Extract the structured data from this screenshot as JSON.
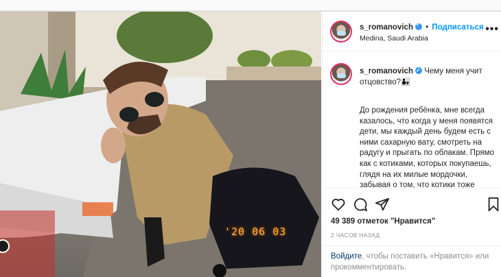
{
  "post": {
    "username": "s_romanovich",
    "follow_label": "Подписаться",
    "location": "Medina, Saudi Arabia",
    "photo_date_stamp": "'20 06 03",
    "caption_first": "Чему меня учит отцовство?",
    "caption_emoji": "👨‍👧",
    "caption_body": "До рождения ребёнка, мне всегда казалось, что когда у меня появятся дети, мы каждый день будем есть с ними сахарную вату, смотреть на радугу и прыгать по облакам. Прямо как с котиками, которых покупаешь, глядя на их милые мордочки, забывая о том, что котики тоже",
    "likes": "49 389 отметок \"Нравится\"",
    "time_ago": "2 ЧАСОВ НАЗАД",
    "login_link": "Войдите",
    "login_rest": ", чтобы поставить «Нравится» или прокомментировать."
  },
  "icons": {
    "like": "heart-icon",
    "comment": "comment-icon",
    "share": "send-icon",
    "save": "bookmark-icon",
    "more": "more-options-icon"
  },
  "colors": {
    "accent": "#0095f6",
    "verified": "#3897f0",
    "muted": "#8e8e8e"
  }
}
